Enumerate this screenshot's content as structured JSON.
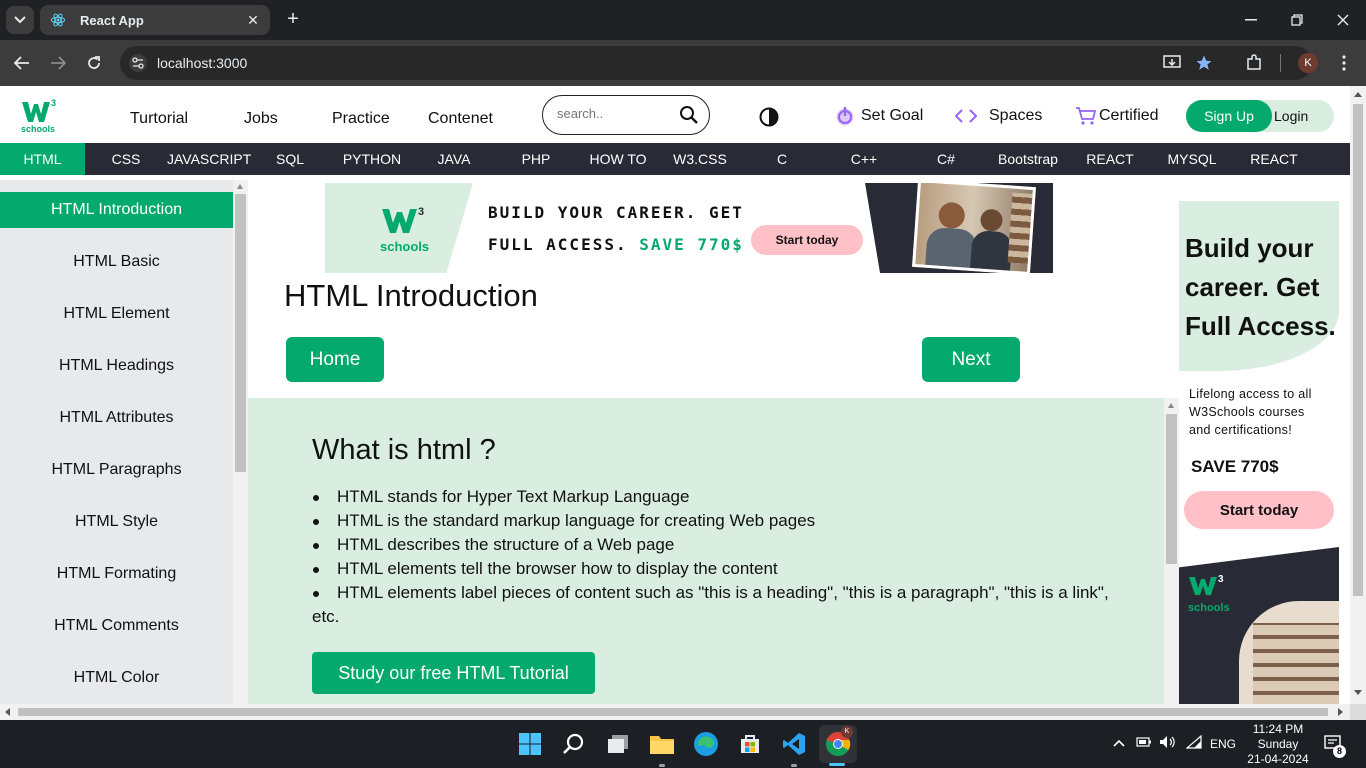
{
  "browser": {
    "tab_title": "React App",
    "url": "localhost:3000",
    "profile_initial": "K"
  },
  "header": {
    "logo_text_top": "W3",
    "logo_text_bottom": "schools",
    "nav": [
      "Turtorial",
      "Jobs",
      "Practice",
      "Contenet"
    ],
    "search_placeholder": "search..",
    "set_goal": "Set Goal",
    "spaces": "Spaces",
    "certified": "Certified",
    "signup": "Sign Up",
    "login": "Login"
  },
  "topnav": [
    "HTML",
    "CSS",
    "JAVASCRIPT",
    "SQL",
    "PYTHON",
    "JAVA",
    "PHP",
    "HOW TO",
    "W3.CSS",
    "C",
    "C++",
    "C#",
    "Bootstrap",
    "REACT",
    "MYSQL",
    "REACT"
  ],
  "sidebar": [
    "HTML Introduction",
    "HTML Basic",
    "HTML Element",
    "HTML Headings",
    "HTML Attributes",
    "HTML Paragraphs",
    "HTML Style",
    "HTML Formating",
    "HTML Comments",
    "HTML Color"
  ],
  "banner": {
    "logo_bottom": "schools",
    "line1": "BUILD YOUR CAREER. GET",
    "line2_a": "FULL ACCESS.",
    "line2_b": "SAVE 770$",
    "button": "Start today"
  },
  "main": {
    "title": "HTML Introduction",
    "home": "Home",
    "next": "Next",
    "section_title": "What is html ?",
    "bullets": [
      "HTML stands for Hyper Text Markup Language",
      "HTML is the standard markup language for creating Web pages",
      "HTML describes the structure of a Web page",
      "HTML elements tell the browser how to display the content",
      "HTML elements label pieces of content such as \"this is a heading\", \"this is a paragraph\", \"this is a link\", etc."
    ],
    "study_button": "Study our free HTML Tutorial"
  },
  "side_ad": {
    "headline_1": "Build your",
    "headline_2": "career. Get",
    "headline_3": "Full Access.",
    "sub_1": "Lifelong access to all",
    "sub_2": "W3Schools courses",
    "sub_3": "and certifications!",
    "save": "SAVE 770$",
    "button": "Start today",
    "logo_bottom": "schools"
  },
  "taskbar": {
    "lang": "ENG",
    "time": "11:24 PM",
    "day": "Sunday",
    "date": "21-04-2024",
    "notif_count": "8"
  },
  "colors": {
    "accent": "#04aa6d",
    "dark": "#282a35",
    "light_green": "#d9eee1",
    "pink": "#ffc0c7"
  }
}
